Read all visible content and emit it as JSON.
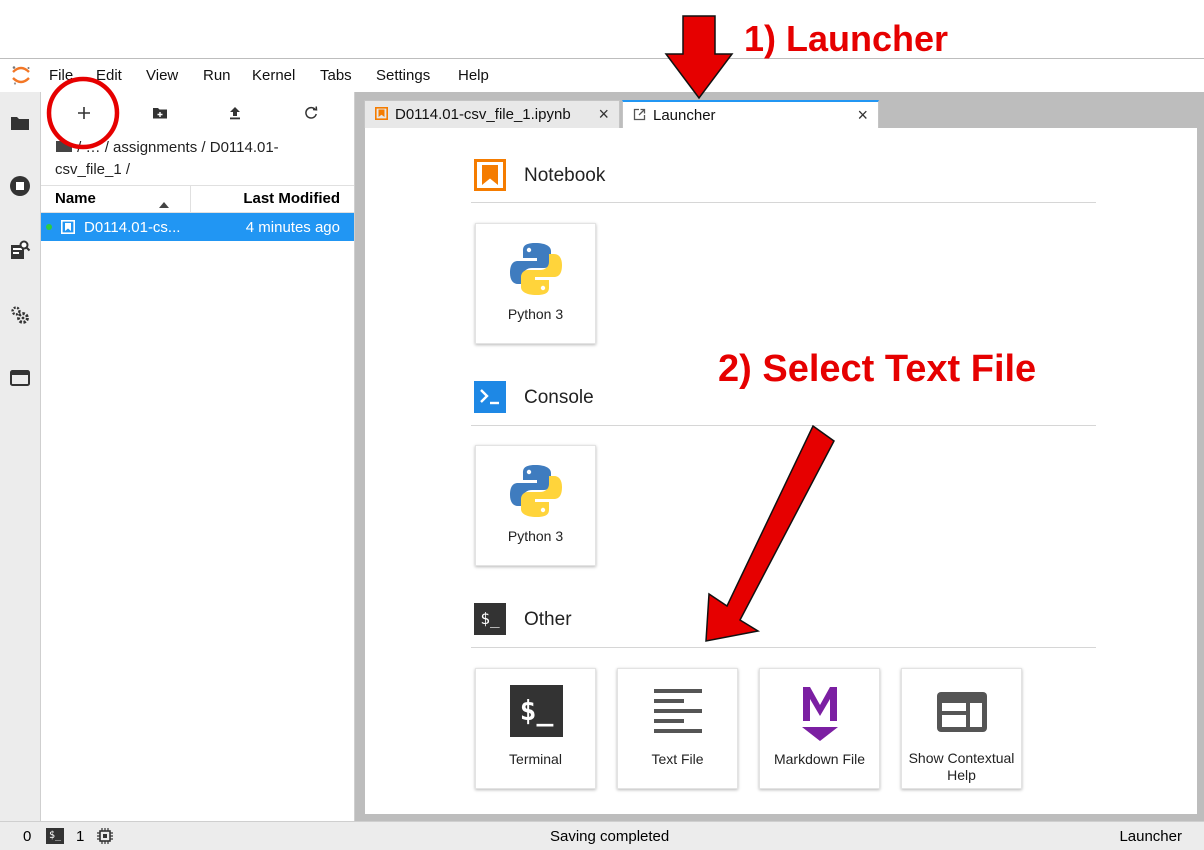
{
  "menu": [
    "File",
    "Edit",
    "View",
    "Run",
    "Kernel",
    "Tabs",
    "Settings",
    "Help"
  ],
  "breadcrumb": {
    "ellipsis": "…",
    "path_text": "/ assignments / D0114.01-csv_file_1 /"
  },
  "file_list": {
    "headers": {
      "name": "Name",
      "modified": "Last Modified"
    },
    "rows": [
      {
        "name": "D0114.01-cs...",
        "modified": "4 minutes ago"
      }
    ]
  },
  "tabs": [
    {
      "label": "D0114.01-csv_file_1.ipynb",
      "close": "×"
    },
    {
      "label": "Launcher",
      "close": "×"
    }
  ],
  "launcher": {
    "sections": [
      {
        "title": "Notebook",
        "cards": [
          "Python 3"
        ]
      },
      {
        "title": "Console",
        "cards": [
          "Python 3"
        ]
      },
      {
        "title": "Other",
        "cards": [
          "Terminal",
          "Text File",
          "Markdown File",
          "Show Contextual Help"
        ],
        "icon_text": "$_"
      }
    ]
  },
  "statusbar": {
    "terminals": "0",
    "kernels": "1",
    "terminal_icon_text": "$_",
    "message": "Saving completed",
    "right": "Launcher"
  },
  "annotations": {
    "step1": "1) Launcher",
    "step2": "2) Select Text File"
  },
  "colors": {
    "accent": "#2196f3",
    "annotation": "#e60000",
    "notebook_orange": "#f57c00",
    "markdown_purple": "#7b1fa2",
    "running_dot": "#2ecc40"
  }
}
